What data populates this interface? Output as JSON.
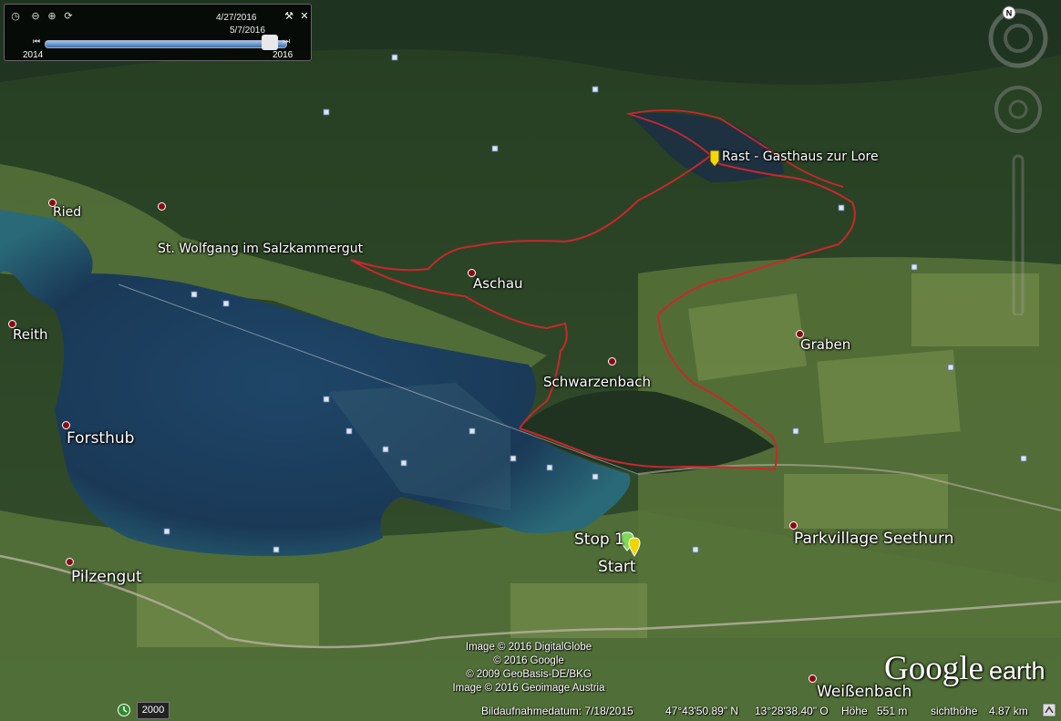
{
  "map": {
    "places": [
      {
        "name": "Ried",
        "size": "sm"
      },
      {
        "name": "St. Wolfgang im Salzkammergut",
        "size": "sm"
      },
      {
        "name": "Aschau",
        "size": "md"
      },
      {
        "name": "Reith",
        "size": "md"
      },
      {
        "name": "Schwarzenbach",
        "size": "md"
      },
      {
        "name": "Graben",
        "size": "md"
      },
      {
        "name": "Forsthub",
        "size": "lg"
      },
      {
        "name": "Parkvillage Seethurn",
        "size": "lg"
      },
      {
        "name": "Pilzengut",
        "size": "lg"
      },
      {
        "name": "Weißenbach",
        "size": "lg"
      }
    ],
    "markers": {
      "rest": "Rast - Gasthaus zur Lore",
      "stop": "Stop 1",
      "start": "Start"
    },
    "route_color": "#c8282d",
    "water_color": "#1e3d5c"
  },
  "time_slider": {
    "date_start": "4/27/2016",
    "date_end": "5/7/2016",
    "year_min": "2014",
    "year_max": "2016",
    "position_fraction": 0.95
  },
  "copyright": [
    "Image © 2016 DigitalGlobe",
    "© 2016 Google",
    "© 2009 GeoBasis-DE/BKG",
    "Image © 2016 Geoimage Austria"
  ],
  "status": {
    "imagery_date": "Bildaufnahmedatum: 7/18/2015",
    "lat": "47°43'50.89\" N",
    "lon": "13°28'38.40\" O",
    "elevation_label": "Höhe",
    "elevation": "551 m",
    "eye_alt_label": "sichthöhe",
    "eye_alt": "4.87 km",
    "historical_year": "2000"
  },
  "logo": {
    "brand": "Google",
    "product": "earth"
  }
}
